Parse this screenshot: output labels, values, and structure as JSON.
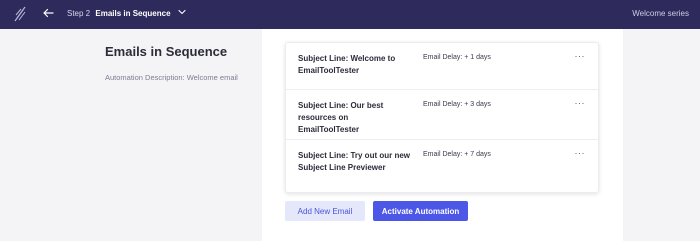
{
  "header": {
    "logo_icon": "feather-logo-icon",
    "back_icon": "arrow-left-icon",
    "step_prefix": "Step 2",
    "step_title": "Emails in Sequence",
    "dropdown_icon": "chevron-down-icon",
    "series_name": "Welcome series",
    "bg_color": "#2e2a5c"
  },
  "sidebar": {
    "title": "Emails in Sequence",
    "description": "Automation Description: Welcome email"
  },
  "emails": [
    {
      "subject": "Subject Line: Welcome to EmailToolTester",
      "delay": "Email Delay: + 1 days",
      "menu": "···"
    },
    {
      "subject": "Subject Line: Our best resources on EmailToolTester",
      "delay": "Email Delay: + 3 days",
      "menu": "···"
    },
    {
      "subject": "Subject Line: Try out our new Subject Line Previewer",
      "delay": "Email Delay: + 7 days",
      "menu": "···"
    }
  ],
  "actions": {
    "add_label": "Add New Email",
    "activate_label": "Activate Automation",
    "accent_color": "#4c57e8"
  }
}
